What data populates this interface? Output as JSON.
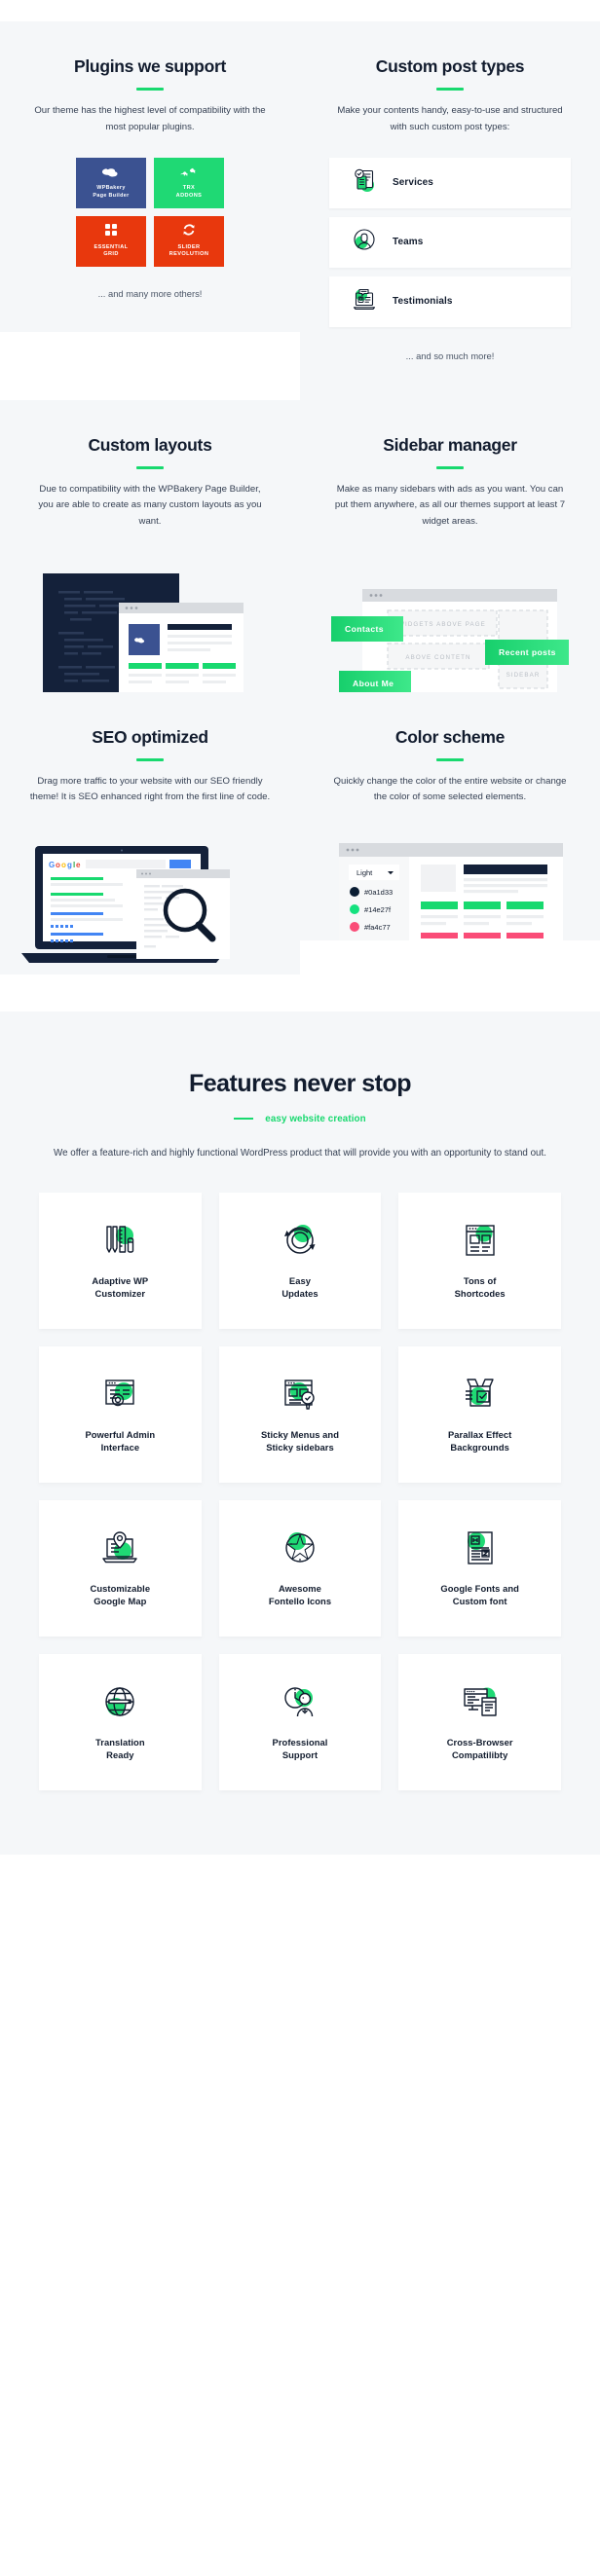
{
  "colors": {
    "accent_green": "#18d96f",
    "dark": "#121c2e",
    "panel_bg": "#f5f7f9",
    "wpbakery_blue": "#3b5291",
    "trx_green": "#1fd974",
    "essential_orange": "#e8380d",
    "slider_orange": "#e8380d",
    "pink": "#fa4c77"
  },
  "sections": {
    "plugins": {
      "title": "Plugins we support",
      "text": "Our theme has the highest level of compatibility with the most popular plugins.",
      "tiles": [
        {
          "icon": "wpbakery-icon",
          "line1": "WPBakery",
          "line2": "Page Builder",
          "style": "wpb"
        },
        {
          "icon": "trx-addons-icon",
          "line1": "TRX",
          "line2": "ADDONS",
          "style": "trx"
        },
        {
          "icon": "essential-grid-icon",
          "line1": "ESSENTIAL",
          "line2": "GRID",
          "style": "esg"
        },
        {
          "icon": "slider-revolution-icon",
          "line1": "SLIDER",
          "line2": "REVOLUTION",
          "style": "srv"
        }
      ],
      "footnote": "... and many more others!"
    },
    "post_types": {
      "title": "Custom post types",
      "text": "Make your contents handy, easy-to-use and structured with such custom post types:",
      "items": [
        {
          "label": "Services",
          "icon": "services-document-icon"
        },
        {
          "label": "Teams",
          "icon": "teams-person-icon"
        },
        {
          "label": "Testimonials",
          "icon": "testimonials-laptop-icon"
        }
      ],
      "footnote": "... and so much more!"
    },
    "layouts": {
      "title": "Custom layouts",
      "text": "Due to compatibility with the WPBakery Page Builder, you are able to create as many custom layouts as you want."
    },
    "sidebar_manager": {
      "title": "Sidebar manager",
      "text": "Make as many sidebars with ads as you want. You can put them anywhere, as all our themes support at least 7 widget areas.",
      "widget_tags": [
        "Contacts",
        "Recent posts",
        "About Me"
      ],
      "widget_slots": [
        "WIDGETS ABOVE PAGE",
        "ABOVE CONTETN",
        "SIDEBAR"
      ]
    },
    "seo": {
      "title": "SEO optimized",
      "text": "Drag more traffic to your website with our SEO friendly theme! It is SEO enhanced right from the first line of code.",
      "browser_brand": "Google"
    },
    "color_scheme": {
      "title": "Color scheme",
      "text": "Quickly change the color of the entire website or change the color of some selected elements.",
      "select_value": "Light",
      "swatches": [
        {
          "label": "#0a1d33",
          "hex": "#0a1d33"
        },
        {
          "label": "#14e27f",
          "hex": "#14e27f"
        },
        {
          "label": "#fa4c77",
          "hex": "#fa4c77"
        }
      ]
    },
    "features": {
      "title": "Features never stop",
      "subtitle": "easy website creation",
      "lead": "We offer a feature-rich and highly functional WordPress product that will provide you with an opportunity to stand out.",
      "cards": [
        {
          "title": "Adaptive WP\nCustomizer",
          "icon": "pencil-ruler-icon"
        },
        {
          "title": "Easy\nUpdates",
          "icon": "refresh-arrows-icon"
        },
        {
          "title": "Tons of\nShortcodes",
          "icon": "layout-blocks-icon"
        },
        {
          "title": "Powerful Admin\nInterface",
          "icon": "window-gear-icon"
        },
        {
          "title": "Sticky Menus and\nSticky sidebars",
          "icon": "window-check-icon"
        },
        {
          "title": "Parallax Effect\nBackgrounds",
          "icon": "open-box-check-icon"
        },
        {
          "title": "Customizable\nGoogle Map",
          "icon": "map-pin-laptop-icon"
        },
        {
          "title": "Awesome\nFontello Icons",
          "icon": "star-badge-icon"
        },
        {
          "title": "Google Fonts and\nCustom font",
          "icon": "typography-page-icon"
        },
        {
          "title": "Translation\nReady",
          "icon": "globe-pen-icon"
        },
        {
          "title": "Professional\nSupport",
          "icon": "support-agent-clock-icon"
        },
        {
          "title": "Cross-Browser\nCompatilibty",
          "icon": "devices-screens-icon"
        }
      ]
    }
  }
}
